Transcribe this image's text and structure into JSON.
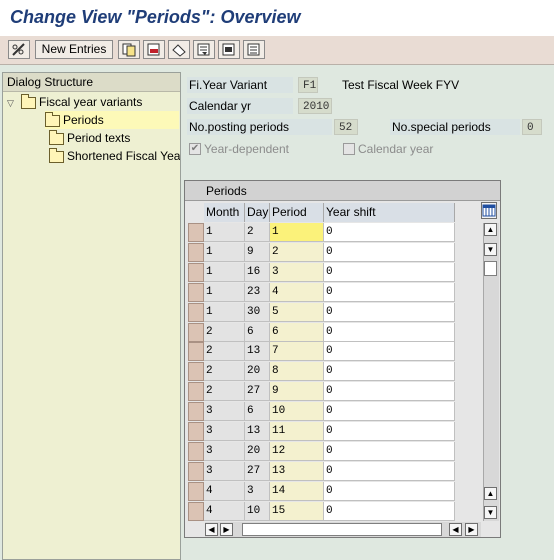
{
  "title": "Change View \"Periods\": Overview",
  "toolbar": {
    "new_entries_label": "New Entries"
  },
  "tree": {
    "header": "Dialog Structure",
    "items": [
      {
        "label": "Fiscal year variants"
      },
      {
        "label": "Periods"
      },
      {
        "label": "Period texts"
      },
      {
        "label": "Shortened Fiscal Yea"
      }
    ]
  },
  "form": {
    "fy_variant_label": "Fi.Year Variant",
    "fy_variant_value": "F1",
    "fy_variant_desc": "Test Fiscal Week FYV",
    "calendar_yr_label": "Calendar yr",
    "calendar_yr_value": "2010",
    "posting_periods_label": "No.posting periods",
    "posting_periods_value": "52",
    "special_periods_label": "No.special periods",
    "special_periods_value": "0",
    "year_dependent_label": "Year-dependent",
    "year_dependent_checked": true,
    "calendar_year_label": "Calendar year",
    "calendar_year_checked": false
  },
  "table": {
    "title": "Periods",
    "columns": [
      "Month",
      "Day",
      "Period",
      "Year shift"
    ],
    "rows": [
      {
        "month": "1",
        "day": "2",
        "period": "1",
        "shift": "0"
      },
      {
        "month": "1",
        "day": "9",
        "period": "2",
        "shift": "0"
      },
      {
        "month": "1",
        "day": "16",
        "period": "3",
        "shift": "0"
      },
      {
        "month": "1",
        "day": "23",
        "period": "4",
        "shift": "0"
      },
      {
        "month": "1",
        "day": "30",
        "period": "5",
        "shift": "0"
      },
      {
        "month": "2",
        "day": "6",
        "period": "6",
        "shift": "0"
      },
      {
        "month": "2",
        "day": "13",
        "period": "7",
        "shift": "0"
      },
      {
        "month": "2",
        "day": "20",
        "period": "8",
        "shift": "0"
      },
      {
        "month": "2",
        "day": "27",
        "period": "9",
        "shift": "0"
      },
      {
        "month": "3",
        "day": "6",
        "period": "10",
        "shift": "0"
      },
      {
        "month": "3",
        "day": "13",
        "period": "11",
        "shift": "0"
      },
      {
        "month": "3",
        "day": "20",
        "period": "12",
        "shift": "0"
      },
      {
        "month": "3",
        "day": "27",
        "period": "13",
        "shift": "0"
      },
      {
        "month": "4",
        "day": "3",
        "period": "14",
        "shift": "0"
      },
      {
        "month": "4",
        "day": "10",
        "period": "15",
        "shift": "0"
      }
    ]
  }
}
